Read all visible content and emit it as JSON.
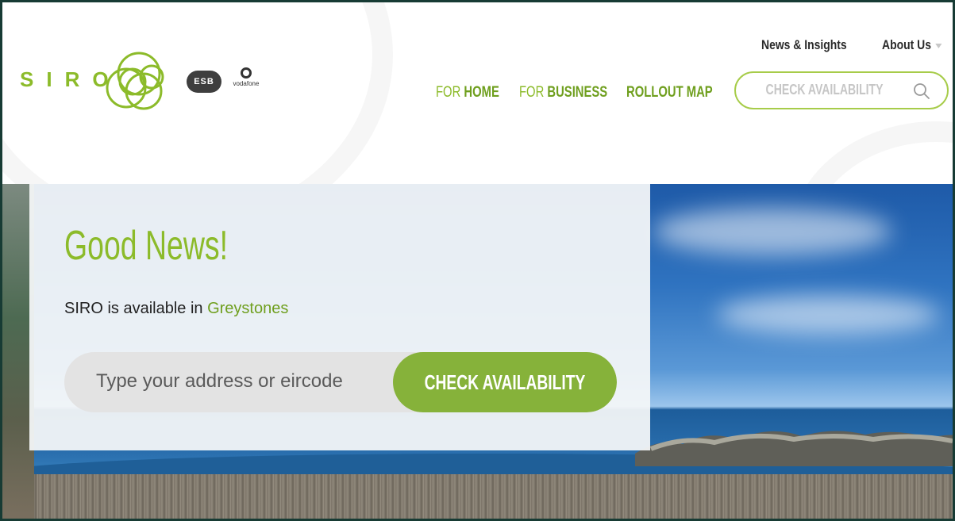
{
  "header": {
    "logo_text": "SIRO",
    "partner_esb": "ESB",
    "partner_vodafone": "vodafone",
    "utility_nav": {
      "news": "News & Insights",
      "about": "About Us"
    },
    "main_nav": [
      {
        "prefix": "FOR",
        "label": "HOME"
      },
      {
        "prefix": "FOR",
        "label": "BUSINESS"
      },
      {
        "prefix": "",
        "label": "ROLLOUT MAP"
      }
    ],
    "search": {
      "placeholder": "CHECK AVAILABILITY",
      "icon": "search-icon"
    }
  },
  "hero": {
    "title": "Good News!",
    "availability_text": "SIRO is available in",
    "town": "Greystones",
    "address_input": {
      "placeholder": "Type your address or eircode"
    },
    "button_label": "CHECK AVAILABILITY"
  },
  "colors": {
    "brand_green": "#8cbb2a",
    "nav_green": "#6f9f1e",
    "button_green": "#86b23a",
    "frame": "#173b34"
  }
}
